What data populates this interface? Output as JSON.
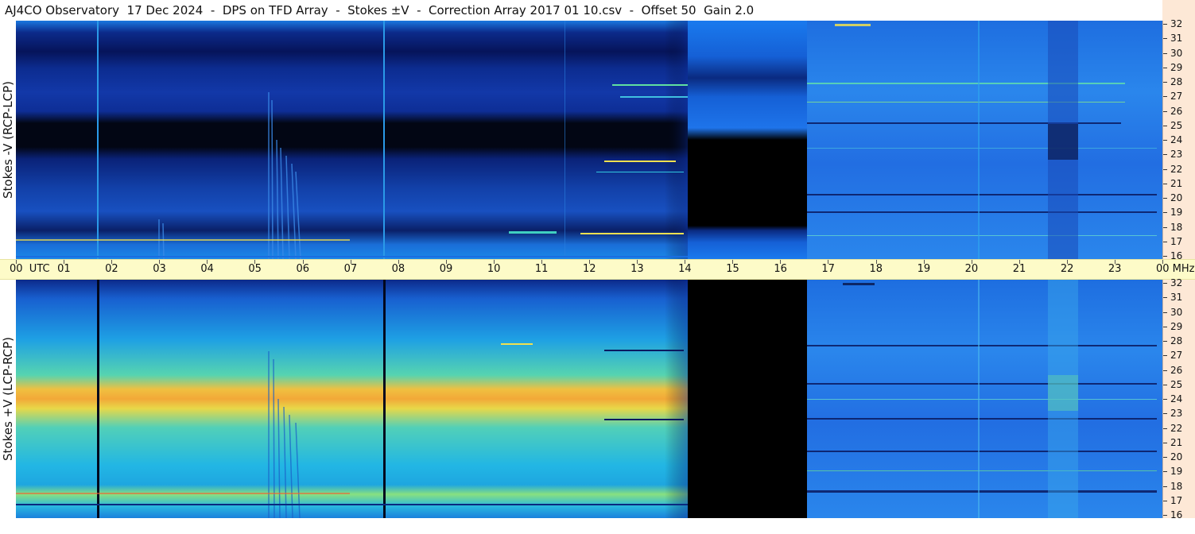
{
  "header": {
    "title": "AJ4CO Observatory  17 Dec 2024  -  DPS on TFD Array  -  Stokes ±V  -  Correction Array 2017 01 10.csv  -  Offset 50  Gain 2.0"
  },
  "panels": {
    "top_label": "Stokes -V (RCP-LCP)",
    "bottom_label": "Stokes +V (LCP-RCP)"
  },
  "time_axis": {
    "hours": [
      "00  UTC",
      "01",
      "02",
      "03",
      "04",
      "05",
      "06",
      "07",
      "08",
      "09",
      "10",
      "11",
      "12",
      "13",
      "14",
      "15",
      "16",
      "17",
      "18",
      "19",
      "20",
      "21",
      "22",
      "23",
      "00 MHz"
    ]
  },
  "freq_axis": {
    "labels": [
      "32",
      "31",
      "30",
      "29",
      "28",
      "27",
      "26",
      "25",
      "24",
      "23",
      "22",
      "21",
      "20",
      "19",
      "18",
      "17",
      "16"
    ]
  },
  "colors": {
    "deep": "#0a1a6e",
    "mid": "#1e5fd8",
    "cyan": "#1fb4e8",
    "green": "#6fdc8c",
    "yellow": "#f5e642",
    "orange": "#f0a030",
    "black": "#000000",
    "axis_bg": "#fdfbc8",
    "scale_bg": "#fde8d6"
  }
}
